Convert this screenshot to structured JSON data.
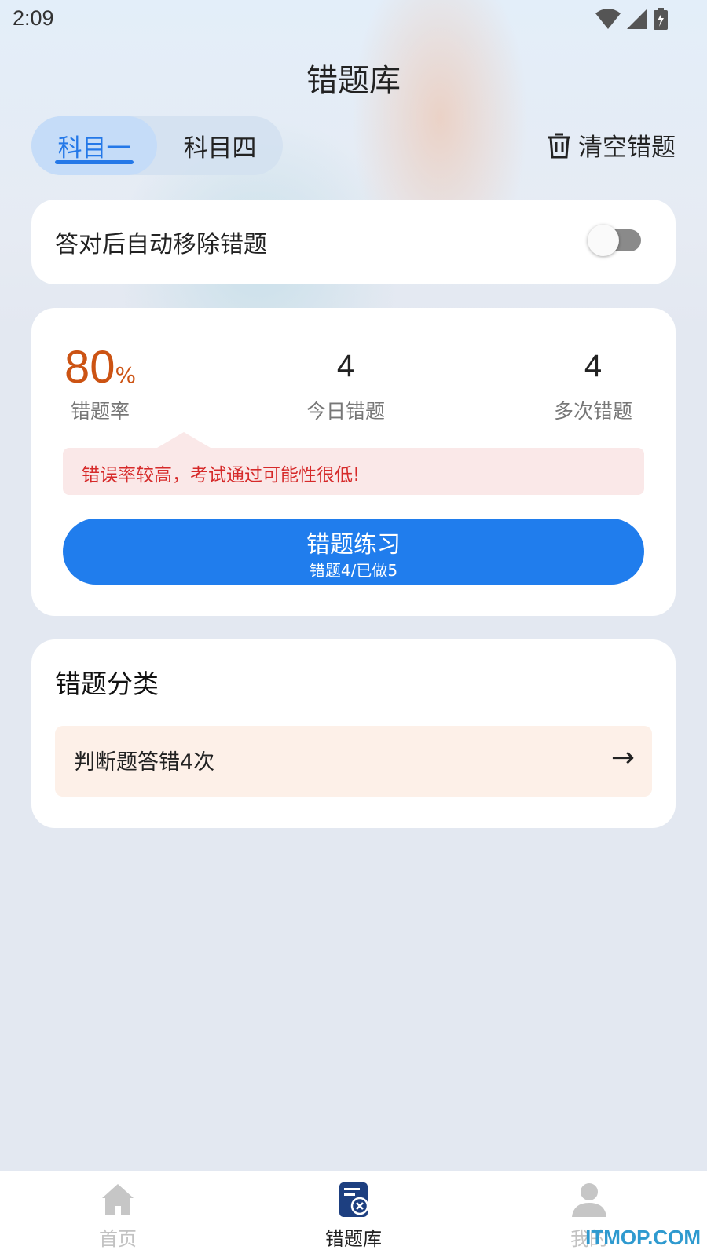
{
  "status_bar": {
    "time": "2:09"
  },
  "header": {
    "title": "错题库"
  },
  "tabs": [
    {
      "label": "科目一",
      "active": true
    },
    {
      "label": "科目四",
      "active": false
    }
  ],
  "clear_button": {
    "label": "清空错题"
  },
  "auto_remove": {
    "label": "答对后自动移除错题",
    "enabled": false
  },
  "stats": {
    "error_rate": {
      "value": "80",
      "unit": "%",
      "label": "错题率"
    },
    "today_errors": {
      "value": "4",
      "label": "今日错题"
    },
    "repeat_errors": {
      "value": "4",
      "label": "多次错题"
    }
  },
  "warning": {
    "text": "错误率较高，考试通过可能性很低!"
  },
  "practice_button": {
    "title": "错题练习",
    "subtitle": "错题4/已做5"
  },
  "category": {
    "title": "错题分类",
    "items": [
      {
        "label": "判断题答错4次"
      }
    ]
  },
  "bottom_nav": [
    {
      "label": "首页",
      "active": false,
      "icon": "home-icon"
    },
    {
      "label": "错题库",
      "active": true,
      "icon": "wrong-question-book-icon"
    },
    {
      "label": "我的",
      "active": false,
      "icon": "user-icon"
    }
  ],
  "watermark": "ITMOP.COM",
  "colors": {
    "accent": "#207ded",
    "error_rate": "#cc5313",
    "warning_text": "#d62a2a"
  }
}
